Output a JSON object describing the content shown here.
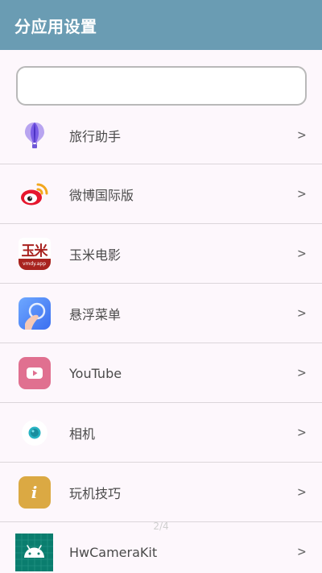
{
  "appbar": {
    "title": "分应用设置"
  },
  "search": {
    "value": "",
    "placeholder": ""
  },
  "items": [
    {
      "label": "旅行助手",
      "icon": "balloon-icon",
      "chevron": ">"
    },
    {
      "label": "微博国际版",
      "icon": "weibo-icon",
      "chevron": ">"
    },
    {
      "label": "玉米电影",
      "icon": "yumi-movie-icon",
      "chevron": ">",
      "icon_text": "玉米",
      "icon_subtext": "vmdy.app"
    },
    {
      "label": "悬浮菜单",
      "icon": "floating-menu-icon",
      "chevron": ">"
    },
    {
      "label": "YouTube",
      "icon": "youtube-icon",
      "chevron": ">"
    },
    {
      "label": "相机",
      "icon": "camera-icon",
      "chevron": ">"
    },
    {
      "label": "玩机技巧",
      "icon": "tips-icon",
      "chevron": ">",
      "icon_text": "i"
    },
    {
      "label": "HwCameraKit",
      "icon": "android-icon",
      "chevron": ">"
    }
  ],
  "page_indicator": "2/4",
  "colors": {
    "appbar": "#6a9cb3",
    "background": "#fdf7fc"
  }
}
